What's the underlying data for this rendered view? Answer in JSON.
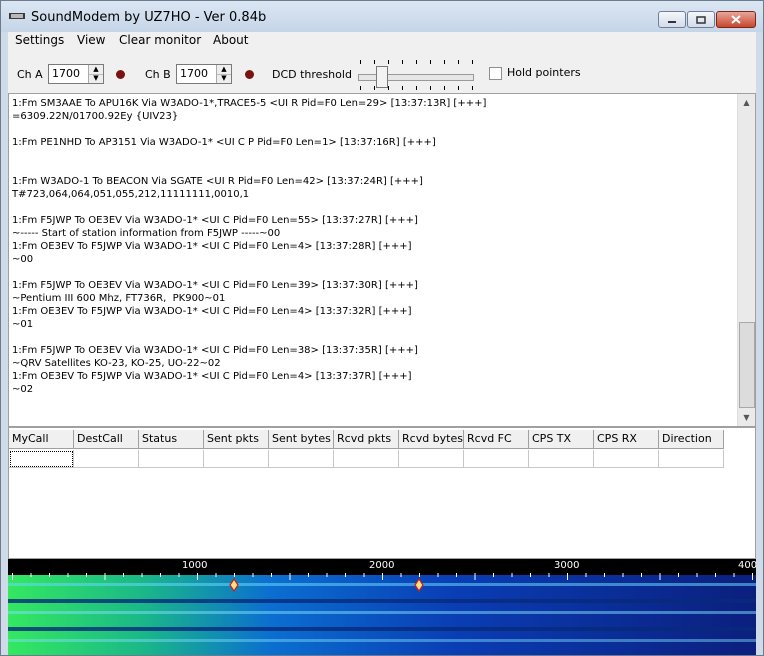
{
  "window": {
    "title": "SoundModem by UZ7HO - Ver 0.84b"
  },
  "menu": [
    "Settings",
    "View",
    "Clear monitor",
    "About"
  ],
  "toolbar": {
    "cha_label": "Ch A",
    "cha_value": "1700",
    "chb_label": "Ch B",
    "chb_value": "1700",
    "dcd_label": "DCD threshold",
    "hold_label": "Hold pointers",
    "hold_checked": false
  },
  "monitor": {
    "lines": [
      "1:Fm SM3AAE To APU16K Via W3ADO-1*,TRACE5-5 <UI R Pid=F0 Len=29> [13:37:13R] [+++]",
      "=6309.22N/01700.92Ey {UIV23}",
      "",
      "1:Fm PE1NHD To AP3151 Via W3ADO-1* <UI C P Pid=F0 Len=1> [13:37:16R] [+++]",
      "",
      "",
      "1:Fm W3ADO-1 To BEACON Via SGATE <UI R Pid=F0 Len=42> [13:37:24R] [+++]",
      "T#723,064,064,051,055,212,11111111,0010,1",
      "",
      "1:Fm F5JWP To OE3EV Via W3ADO-1* <UI C Pid=F0 Len=55> [13:37:27R] [+++]",
      "~----- Start of station information from F5JWP -----~00",
      "1:Fm OE3EV To F5JWP Via W3ADO-1* <UI C Pid=F0 Len=4> [13:37:28R] [+++]",
      "~00",
      "",
      "1:Fm F5JWP To OE3EV Via W3ADO-1* <UI C Pid=F0 Len=39> [13:37:30R] [+++]",
      "~Pentium III 600 Mhz, FT736R,  PK900~01",
      "1:Fm OE3EV To F5JWP Via W3ADO-1* <UI C Pid=F0 Len=4> [13:37:32R] [+++]",
      "~01",
      "",
      "1:Fm F5JWP To OE3EV Via W3ADO-1* <UI C Pid=F0 Len=38> [13:37:35R] [+++]",
      "~QRV Satellites KO-23, KO-25, UO-22~02",
      "1:Fm OE3EV To F5JWP Via W3ADO-1* <UI C Pid=F0 Len=4> [13:37:37R] [+++]",
      "~02"
    ]
  },
  "grid": {
    "columns": [
      "MyCall",
      "DestCall",
      "Status",
      "Sent pkts",
      "Sent bytes",
      "Rcvd pkts",
      "Rcvd bytes",
      "Rcvd FC",
      "CPS TX",
      "CPS RX",
      "Direction"
    ]
  },
  "waterfall": {
    "scale_labels": [
      "1000",
      "2000",
      "3000",
      "400"
    ],
    "marker_hz": [
      1200,
      2200
    ]
  },
  "colors": {
    "titlebar": "#c5d5e8",
    "close_button": "#c8462f",
    "led": "#7a1212",
    "waterfall_bg": "#000000"
  }
}
